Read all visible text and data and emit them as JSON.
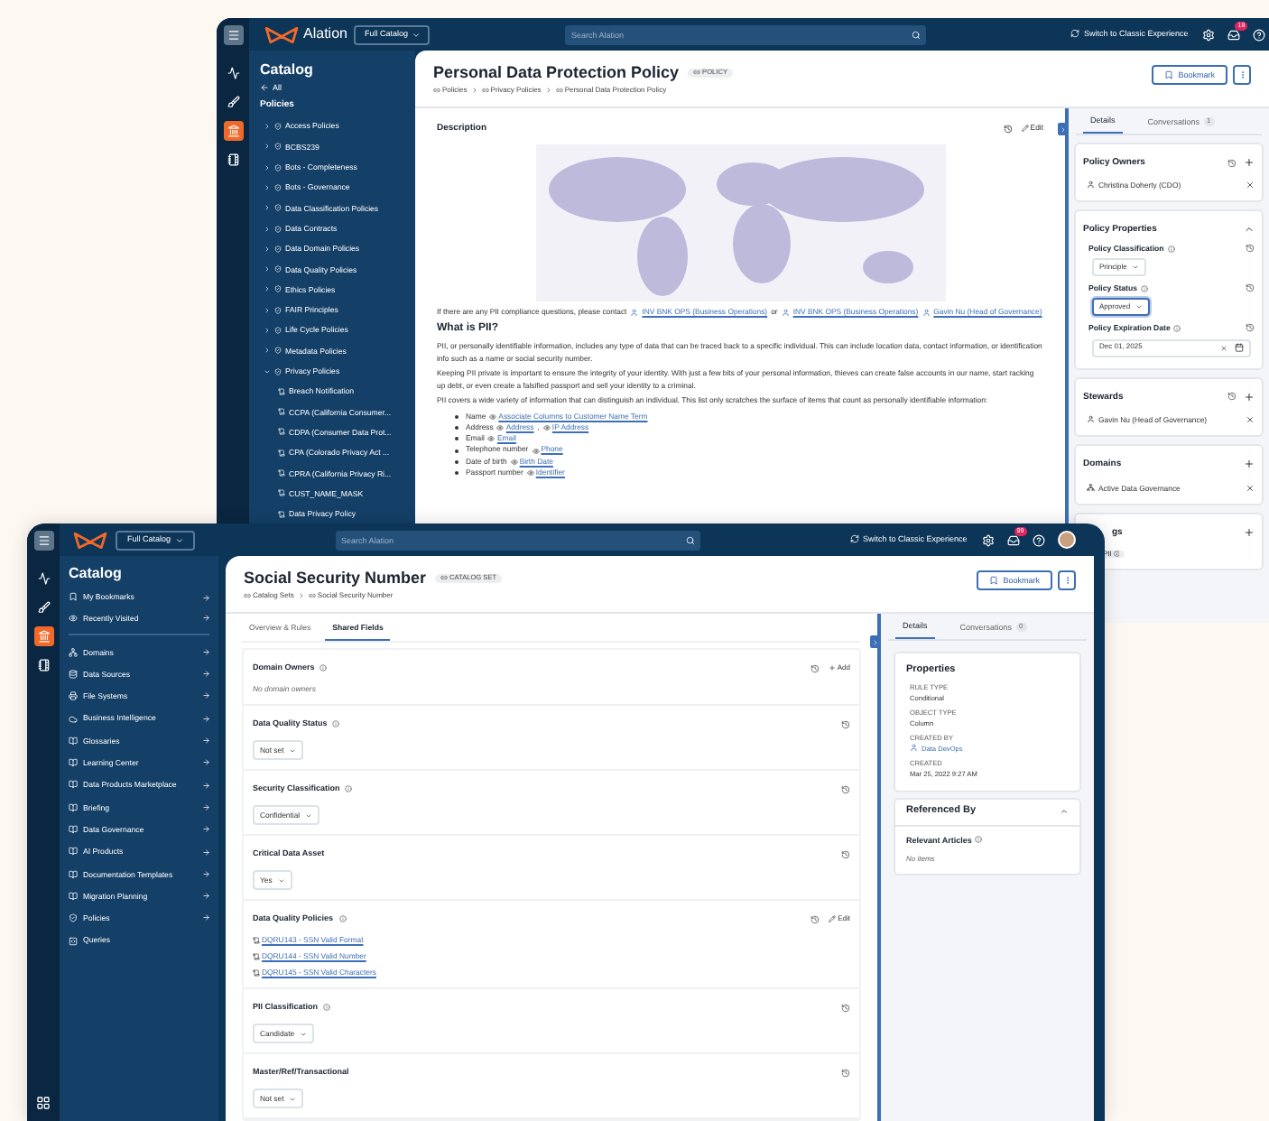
{
  "back_window": {
    "top_bar": {
      "logo_text": "Alation",
      "catalog_menu": "Full Catalog",
      "search_placeholder": "Search Alation",
      "switch_link": "Switch to Classic Experience",
      "notification_count": "19"
    },
    "rail": [
      {
        "selected": false
      },
      {
        "selected": false
      },
      {
        "selected": true
      },
      {
        "selected": false
      }
    ],
    "sidebar": {
      "title": "Catalog",
      "back_link": "All",
      "section": "Policies",
      "items": [
        {
          "label": "Access Policies",
          "expanded": false
        },
        {
          "label": "BCBS239",
          "expanded": false
        },
        {
          "label": "Bots - Completeness",
          "expanded": false
        },
        {
          "label": "Bots - Governance",
          "expanded": false
        },
        {
          "label": "Data Classification Policies",
          "expanded": false
        },
        {
          "label": "Data Contracts",
          "expanded": false
        },
        {
          "label": "Data Domain Policies",
          "expanded": false
        },
        {
          "label": "Data Quality Policies",
          "expanded": false
        },
        {
          "label": "Ethics Policies",
          "expanded": false
        },
        {
          "label": "FAIR Principles",
          "expanded": false
        },
        {
          "label": "Life Cycle Policies",
          "expanded": false
        },
        {
          "label": "Metadata Policies",
          "expanded": false
        },
        {
          "label": "Privacy Policies",
          "expanded": true,
          "children": [
            {
              "label": "Breach Notification"
            },
            {
              "label": "CCPA (California Consumer..."
            },
            {
              "label": "CDPA (Consumer Data Prot..."
            },
            {
              "label": "CPA (Colorado Privacy Act ..."
            },
            {
              "label": "CPRA (California Privacy Ri..."
            },
            {
              "label": "CUST_NAME_MASK"
            },
            {
              "label": "Data Privacy Policy"
            }
          ]
        }
      ]
    },
    "header": {
      "title": "Personal Data Protection Policy",
      "badge": "POLICY",
      "breadcrumbs": [
        "Policies",
        "Privacy Policies",
        "Personal Data Protection Policy"
      ],
      "bookmark": "Bookmark"
    },
    "description": {
      "title": "Description",
      "edit": "Edit",
      "contact": [
        {
          "kind": "text",
          "text": "If there are any PII compliance questions, please contact"
        },
        {
          "kind": "person",
          "text": "INV BNK OPS (Business Operations)"
        },
        {
          "kind": "text",
          "text": "or"
        },
        {
          "kind": "person",
          "text": "INV BNK OPS (Business Operations)"
        },
        {
          "kind": "person",
          "text": "Gavin Nu (Head of Governance)"
        }
      ],
      "heading": "What is PII?",
      "paragraphs": [
        "PII, or personally identifiable information, includes any type of data that can be traced back to a specific individual. This can include location data, contact information, or identification info such as a name or social security number.",
        "Keeping PII private is important to ensure the integrity of your identity. With just a few bits of your personal information, thieves can create false accounts in our name, start racking up debt, or even create a falsified passport and sell your identity to a criminal.",
        "PII covers a wide variety of information that can distinguish an individual. This list only scratches the surface of items that count as personally identifiable information:"
      ],
      "list": [
        {
          "parts": [
            {
              "kind": "text",
              "text": "Name"
            },
            {
              "kind": "term",
              "text": "Associate Columns to Customer Name Term"
            }
          ]
        },
        {
          "parts": [
            {
              "kind": "text",
              "text": "Address"
            },
            {
              "kind": "term",
              "text": "Address"
            },
            {
              "kind": "text",
              "text": ","
            },
            {
              "kind": "term",
              "text": "IP Address"
            }
          ]
        },
        {
          "parts": [
            {
              "kind": "text",
              "text": "Email"
            },
            {
              "kind": "term",
              "text": "Email"
            }
          ]
        },
        {
          "parts": [
            {
              "kind": "text",
              "text": "Telephone number"
            },
            {
              "kind": "term",
              "text": "Phone"
            }
          ]
        },
        {
          "parts": [
            {
              "kind": "text",
              "text": "Date of birth"
            },
            {
              "kind": "term",
              "text": "Birth Date"
            }
          ]
        },
        {
          "parts": [
            {
              "kind": "text",
              "text": "Passport number"
            },
            {
              "kind": "term",
              "text": "Identifier"
            }
          ]
        }
      ]
    },
    "details_panel": {
      "tabs": [
        {
          "label": "Details",
          "selected": true
        },
        {
          "label": "Conversations",
          "count": "1",
          "selected": false
        }
      ],
      "cards": [
        {
          "kind": "people",
          "title": "Policy Owners",
          "people": [
            "Christina Doherty (CDO)"
          ]
        },
        {
          "kind": "properties",
          "title": "Policy Properties",
          "expanded": true,
          "fields": [
            {
              "kind": "select",
              "label": "Policy Classification",
              "value": "Principle",
              "focused": false
            },
            {
              "kind": "select",
              "label": "Policy Status",
              "value": "Approved",
              "focused": true
            },
            {
              "kind": "date",
              "label": "Policy Expiration Date",
              "value": "Dec 01, 2025"
            }
          ]
        },
        {
          "kind": "people",
          "title": "Stewards",
          "people": [
            "Gavin Nu (Head of Governance)"
          ]
        },
        {
          "kind": "domains",
          "title": "Domains",
          "domains": [
            "Active Data Governance"
          ]
        },
        {
          "kind": "tags",
          "title": "gs",
          "tags": [
            "PII"
          ]
        }
      ]
    }
  },
  "front_window": {
    "top_bar": {
      "catalog_menu": "Full Catalog",
      "search_placeholder": "Search Alation",
      "switch_link": "Switch to Classic Experience",
      "notification_count": "99"
    },
    "rail": [
      {
        "selected": false
      },
      {
        "selected": false
      },
      {
        "selected": true
      },
      {
        "selected": false
      }
    ],
    "sidebar": {
      "title": "Catalog",
      "pinned": [
        {
          "label": "My Bookmarks"
        },
        {
          "label": "Recently Visited"
        }
      ],
      "items": [
        {
          "label": "Domains",
          "arrow": true
        },
        {
          "label": "Data Sources",
          "arrow": true
        },
        {
          "label": "File Systems",
          "arrow": true
        },
        {
          "label": "Business Intelligence",
          "arrow": true
        },
        {
          "label": "Glossaries",
          "arrow": true
        },
        {
          "label": "Learning Center",
          "arrow": true
        },
        {
          "label": "Data Products Marketplace",
          "arrow": true
        },
        {
          "label": "Briefing",
          "arrow": true
        },
        {
          "label": "Data Governance",
          "arrow": true
        },
        {
          "label": "AI Products",
          "arrow": true
        },
        {
          "label": "Documentation Templates",
          "arrow": true
        },
        {
          "label": "Migration Planning",
          "arrow": true
        },
        {
          "label": "Policies",
          "arrow": true
        },
        {
          "label": "Queries",
          "arrow": false
        }
      ]
    },
    "header": {
      "title": "Social Security Number",
      "badge": "CATALOG SET",
      "breadcrumbs": [
        "Catalog Sets",
        "Social Security Number"
      ],
      "bookmark": "Bookmark"
    },
    "tabs": [
      {
        "label": "Overview & Rules",
        "selected": false
      },
      {
        "label": "Shared Fields",
        "selected": true
      }
    ],
    "fields": [
      {
        "kind": "people",
        "label": "Domain Owners",
        "info": true,
        "action": "Add",
        "empty_text": "No domain owners"
      },
      {
        "kind": "select",
        "label": "Data Quality Status",
        "info": true,
        "value": "Not set"
      },
      {
        "kind": "select",
        "label": "Security Classification",
        "info": true,
        "value": "Confidential"
      },
      {
        "kind": "select",
        "label": "Critical Data Asset",
        "info": false,
        "value": "Yes"
      },
      {
        "kind": "links",
        "label": "Data Quality Policies",
        "info": true,
        "action": "Edit",
        "links": [
          "DQRU143 - SSN Valid Format",
          "DQRU144 - SSN Valid Number",
          "DQRU145 - SSN Valid Characters"
        ]
      },
      {
        "kind": "select",
        "label": "PII Classification",
        "info": true,
        "value": "Candidate"
      },
      {
        "kind": "select",
        "label": "Master/Ref/Transactional",
        "info": false,
        "value": "Not set"
      }
    ],
    "details_panel": {
      "tabs": [
        {
          "label": "Details",
          "selected": true
        },
        {
          "label": "Conversations",
          "count": "0",
          "selected": false
        }
      ],
      "properties": {
        "title": "Properties",
        "rows": [
          {
            "kind": "text",
            "label": "RULE TYPE",
            "value": "Conditional"
          },
          {
            "kind": "text",
            "label": "OBJECT TYPE",
            "value": "Column"
          },
          {
            "kind": "person",
            "label": "CREATED BY",
            "value": "Data DevOps"
          },
          {
            "kind": "text",
            "label": "CREATED",
            "value": "Mar 25, 2022 9:27 AM"
          }
        ]
      },
      "referenced_by": {
        "title": "Referenced By",
        "expanded": true,
        "section": "Relevant Articles",
        "empty_text": "No items"
      }
    }
  }
}
